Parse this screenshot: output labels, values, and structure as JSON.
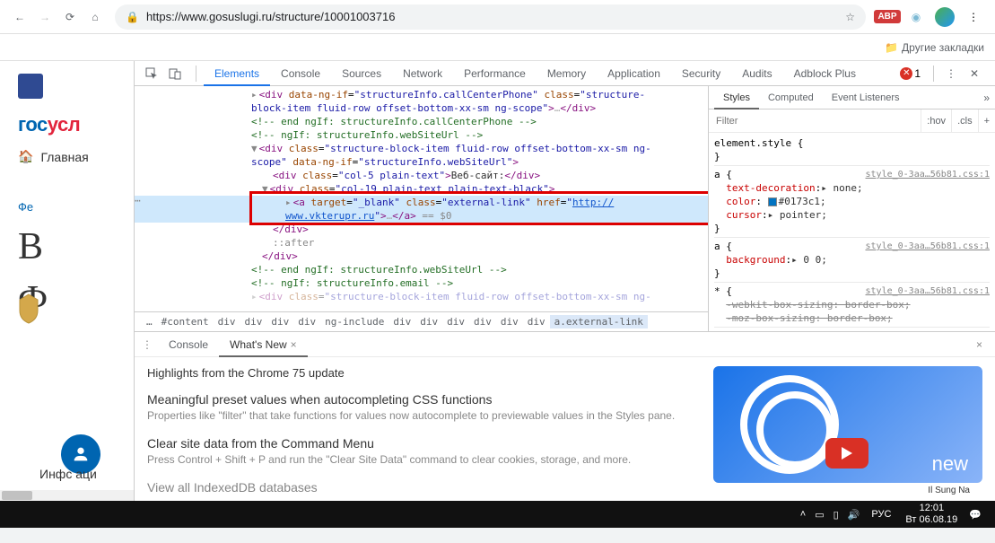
{
  "browser": {
    "url": "https://www.gosuslugi.ru/structure/10001003716",
    "abp_label": "ABP",
    "bookmarks_other": "Другие закладки"
  },
  "page": {
    "logo_prefix": "гос",
    "logo_suffix": "усл",
    "home_link": "Главная",
    "fed_text": "Фе",
    "big1": "В",
    "big2": "Ф",
    "info_text": "Инфс        аци"
  },
  "devtools": {
    "tabs": [
      "Elements",
      "Console",
      "Sources",
      "Network",
      "Performance",
      "Memory",
      "Application",
      "Security",
      "Audits",
      "Adblock Plus"
    ],
    "error_count": "1",
    "code": {
      "l1": "▸<div data-ng-if=\"structureInfo.callCenterPhone\" class=\"structure-",
      "l1b": "block-item fluid-row offset-bottom-xx-sm ng-scope\">…</div>",
      "l2": "<!-- end ngIf: structureInfo.callCenterPhone -->",
      "l3": "<!-- ngIf: structureInfo.webSiteUrl -->",
      "l4": "▼<div class=\"structure-block-item fluid-row offset-bottom-xx-sm ng-",
      "l4b": "scope\" data-ng-if=\"structureInfo.webSiteUrl\">",
      "l5a": "<div class=\"col-5 plain-text\">",
      "l5t": "Веб-сайт:",
      "l5c": "</div>",
      "l6": "▼<div class=\"col-19 plain-text plain-text-black\">",
      "l7a": "▸<a target=\"_blank\" class=\"external-link\" href=\"",
      "l7u": "http://www.vkterupr.ru",
      "l7c": "\">…</a>",
      "l7eq": " == $0",
      "l8": "</div>",
      "l9": "::after",
      "l10": "</div>",
      "l11": "<!-- end ngIf: structureInfo.webSiteUrl -->",
      "l12": "<!-- ngIf: structureInfo.email -->",
      "l13": "▸<div class=\"structure-block-item fluid-row offset-bottom-xx-sm ng-"
    },
    "crumbs": [
      "…",
      "#content",
      "div",
      "div",
      "div",
      "div",
      "ng-include",
      "div",
      "div",
      "div",
      "div",
      "div",
      "div",
      "a.external-link"
    ],
    "styles": {
      "tabs": [
        "Styles",
        "Computed",
        "Event Listeners"
      ],
      "filter_placeholder": "Filter",
      "hov": ":hov",
      "cls": ".cls",
      "elem_style": "element.style {",
      "brace_close": "}",
      "rule1_sel": "a {",
      "rule1_src": "style_0-3aa…56b81.css:1",
      "rule1_p1n": "text-decoration",
      "rule1_p1v": "▸ none;",
      "rule1_p2n": "color",
      "rule1_p2v": "#0173c1;",
      "rule1_p3n": "cursor",
      "rule1_p3v": "▸ pointer;",
      "rule2_sel": "a {",
      "rule2_src": "style_0-3aa…56b81.css:1",
      "rule2_p1n": "background",
      "rule2_p1v": "▸ 0 0;",
      "rule3_sel": "* {",
      "rule3_src": "style_0-3aa…56b81.css:1",
      "rule3_p1": "-webkit-box-sizing: border-box;",
      "rule3_p2": "-moz-box-sizing: border-box;"
    },
    "drawer": {
      "tabs": [
        "Console",
        "What's New"
      ],
      "close_x": "×",
      "headline": "Highlights from the Chrome 75 update",
      "f1_title": "Meaningful preset values when autocompleting CSS functions",
      "f1_desc": "Properties like \"filter\" that take functions for values now autocomplete to previewable values in the Styles pane.",
      "f2_title": "Clear site data from the Command Menu",
      "f2_desc": "Press Control + Shift + P and run the \"Clear Site Data\" command to clear cookies, storage, and more.",
      "f3_title": "View all IndexedDB databases",
      "promo_text": "new",
      "promo_caption": "Il Sung Na"
    }
  },
  "taskbar": {
    "lang": "РУС",
    "time": "12:01",
    "date": "Вт 06.08.19"
  }
}
